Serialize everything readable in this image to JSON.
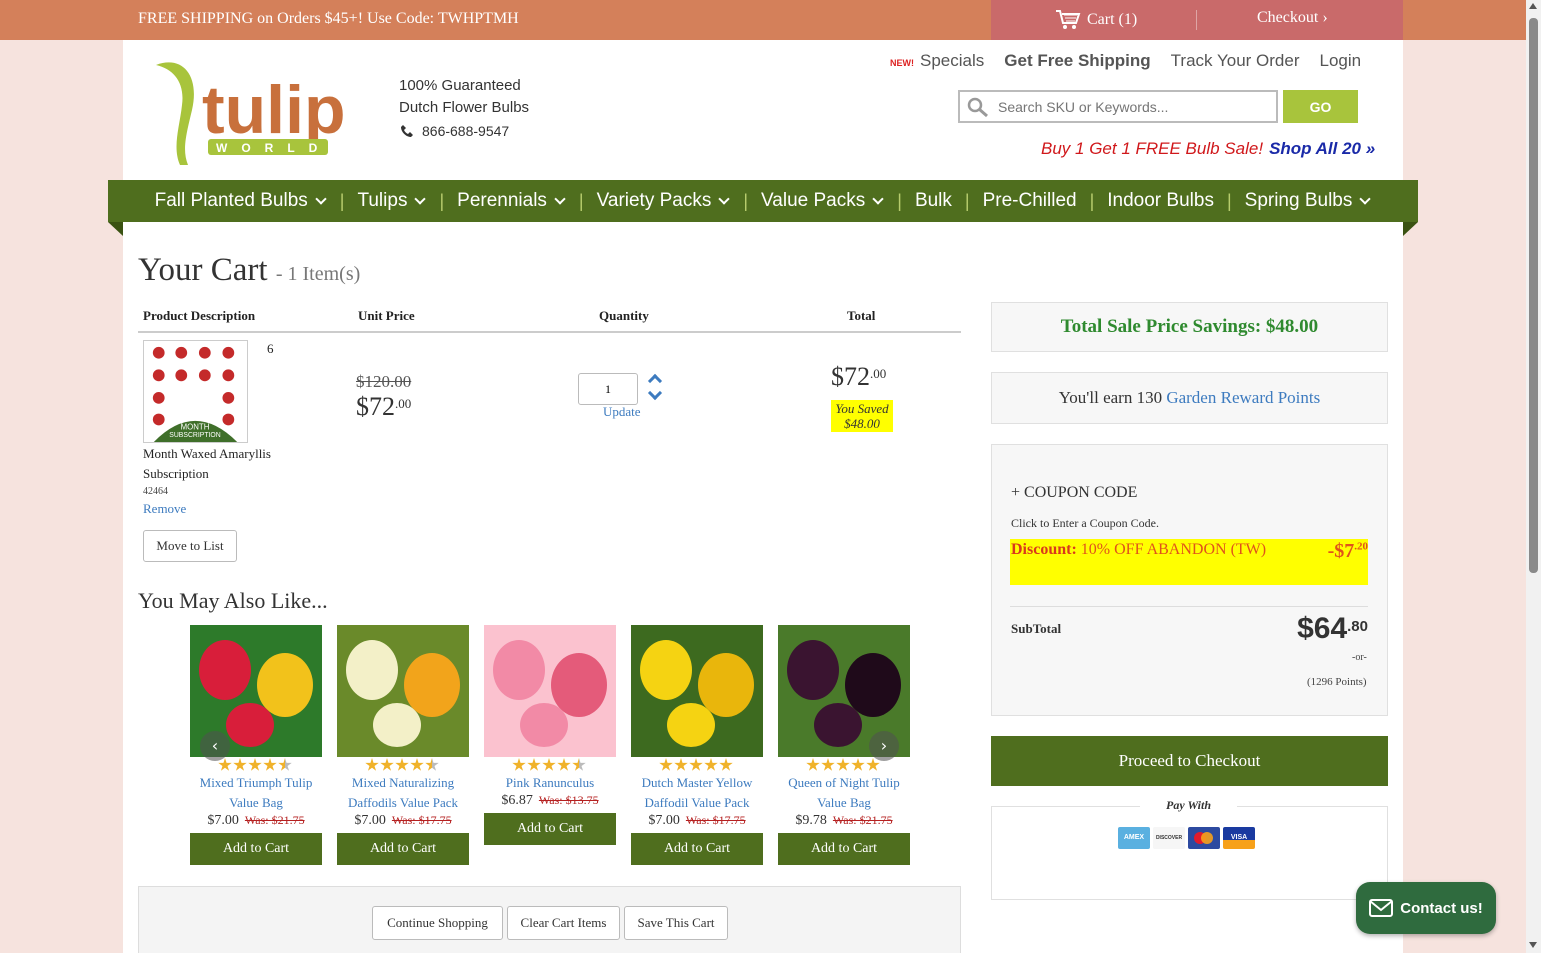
{
  "topbar": {
    "promo": "FREE SHIPPING on Orders $45+! Use Code: TWHPTMH",
    "cart_label": "Cart (1)",
    "checkout_label": "Checkout"
  },
  "header": {
    "guarantee_line1": "100% Guaranteed",
    "guarantee_line2": "Dutch Flower Bulbs",
    "phone": "866-688-9547",
    "new_badge": "NEW!",
    "links": [
      "Specials",
      "Get Free Shipping",
      "Track Your Order",
      "Login"
    ],
    "search_placeholder": "Search SKU or Keywords...",
    "go_label": "GO",
    "bogo_text": "Buy 1 Get 1 FREE Bulb Sale!",
    "bogo_link": "Shop All 20 »"
  },
  "nav": [
    {
      "label": "Fall Planted Bulbs",
      "dropdown": true
    },
    {
      "label": "Tulips",
      "dropdown": true
    },
    {
      "label": "Perennials",
      "dropdown": true
    },
    {
      "label": "Variety Packs",
      "dropdown": true
    },
    {
      "label": "Value Packs",
      "dropdown": true
    },
    {
      "label": "Bulk",
      "dropdown": false
    },
    {
      "label": "Pre-Chilled",
      "dropdown": false
    },
    {
      "label": "Indoor Bulbs",
      "dropdown": false
    },
    {
      "label": "Spring Bulbs",
      "dropdown": true
    }
  ],
  "cart": {
    "title": "Your Cart",
    "count": "- 1 Item(s)",
    "headers": {
      "product": "Product Description",
      "unit": "Unit Price",
      "qty": "Quantity",
      "total": "Total"
    },
    "item": {
      "badge": "6",
      "image_text": "6 MONTH SUBSCRIPTION",
      "name": "Month Waxed Amaryllis Subscription",
      "sku": "42464",
      "remove": "Remove",
      "move": "Move to List",
      "was_price": "$120.00",
      "unit_main": "$72",
      "unit_cents": ".00",
      "qty": "1",
      "update": "Update",
      "total_main": "$72",
      "total_cents": ".00",
      "saved_line1": "You Saved",
      "saved_line2": "$48.00"
    }
  },
  "recommendations": {
    "title": "You May Also Like...",
    "items": [
      {
        "name": "Mixed Triumph Tulip Value Bag",
        "price": "$7.00",
        "was": "Was: $21.75",
        "rating": 4.5,
        "add": "Add to Cart"
      },
      {
        "name": "Mixed Naturalizing Daffodils Value Pack",
        "price": "$7.00",
        "was": "Was: $17.75",
        "rating": 4.5,
        "add": "Add to Cart"
      },
      {
        "name": "Pink Ranunculus",
        "price": "$6.87",
        "was": "Was: $13.75",
        "rating": 4.5,
        "add": "Add to Cart"
      },
      {
        "name": "Dutch Master Yellow Daffodil Value Pack",
        "price": "$7.00",
        "was": "Was: $17.75",
        "rating": 5,
        "add": "Add to Cart"
      },
      {
        "name": "Queen of Night Tulip Value Bag",
        "price": "$9.78",
        "was": "Was: $21.75",
        "rating": 5,
        "add": "Add to Cart"
      }
    ]
  },
  "actions": {
    "continue": "Continue Shopping",
    "clear": "Clear Cart Items",
    "save": "Save This Cart"
  },
  "summary": {
    "savings": "Total Sale Price Savings: $48.00",
    "reward_prefix": "You'll earn 130",
    "reward_link": "Garden Reward Points",
    "coupon_head": "+ COUPON CODE",
    "coupon_sub": "Click to Enter a Coupon Code.",
    "discount_label": "Discount:",
    "discount_desc": "10% OFF ABANDON (TW)",
    "discount_amount": "-$7",
    "discount_cents": ".20",
    "subtotal_label": "SubTotal",
    "subtotal_main": "$64",
    "subtotal_cents": ".80",
    "or": "-or-",
    "points": "(1296 Points)",
    "checkout": "Proceed to Checkout",
    "pay_with": "Pay With",
    "cards": [
      "AMEX",
      "DISCOVER",
      "MC",
      "VISA"
    ]
  },
  "contact": "Contact us!",
  "colors": {
    "accent_green": "#4f6e1e",
    "topbar": "#d4805a",
    "link": "#3d7bbf"
  }
}
